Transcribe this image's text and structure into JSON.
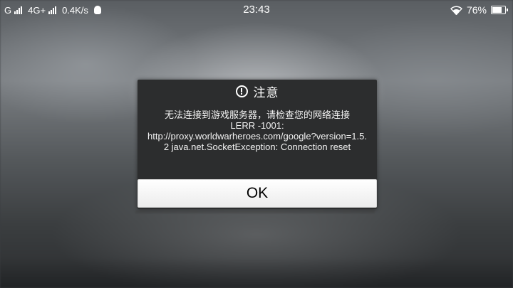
{
  "status_bar": {
    "carrier1": "G",
    "carrier2": "4G+",
    "speed": "0.4K/s",
    "time": "23:43",
    "battery_percent": "76%",
    "battery_level": 0.76,
    "icons": [
      "signal-bars-icon",
      "qq-penguin-icon",
      "wifi-icon",
      "battery-icon"
    ]
  },
  "dialog": {
    "title": "注意",
    "icon": "exclamation-circle-icon",
    "message_lines": [
      "无法连接到游戏服务器，请检查您的网络连接",
      "LERR -1001:",
      "http://proxy.worldwarheroes.com/google?version=1.5.2 java.net.SocketException: Connection reset"
    ],
    "ok_label": "OK"
  },
  "colors": {
    "dialog_bg": "#2c2d2e",
    "button_bg": "#ffffff",
    "text_light": "#ffffff"
  }
}
